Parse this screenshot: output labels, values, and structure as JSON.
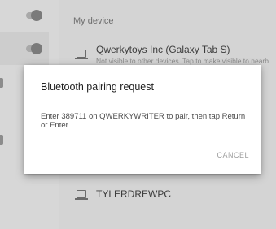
{
  "sidebar": {
    "toggles": [
      {
        "state": "on"
      },
      {
        "state": "on"
      }
    ]
  },
  "settings": {
    "section_header": "My device",
    "this_device": {
      "name": "Qwerkytoys Inc (Galaxy Tab S)",
      "subtitle": "Not visible to other devices. Tap to make visible to nearb"
    },
    "paired_device": {
      "name": "TYLERDREWPC"
    }
  },
  "dialog": {
    "title": "Bluetooth pairing request",
    "message": "Enter 389711 on QWERKYWRITER to pair, then tap Return or Enter.",
    "cancel_label": "CANCEL"
  },
  "colors": {
    "background": "#d4d4d4",
    "dialog_background": "#ffffff",
    "title_text": "#212121",
    "cancel_text": "#9e9e9e"
  }
}
